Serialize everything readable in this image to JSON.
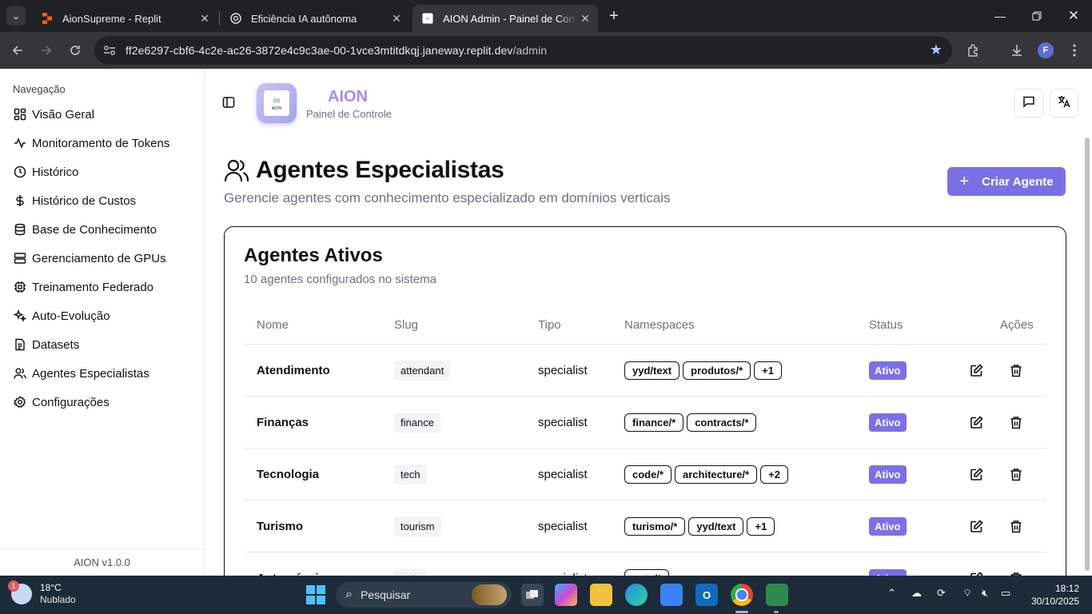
{
  "browser": {
    "tabs": [
      {
        "title": "AionSupreme - Replit",
        "active": false
      },
      {
        "title": "Eficiência IA autônoma",
        "active": false
      },
      {
        "title": "AION Admin - Painel de Controle",
        "active": true
      }
    ],
    "url_host": "ff2e6297-cbf6-4c2e-ac26-3872e4c9c3ae-00-1vce3mtitdkqj.janeway.replit.dev",
    "url_path": "/admin",
    "profile_initial": "F"
  },
  "sidebar": {
    "heading": "Navegação",
    "items": [
      {
        "label": "Visão Geral",
        "icon": "grid-icon"
      },
      {
        "label": "Monitoramento de Tokens",
        "icon": "activity-icon"
      },
      {
        "label": "Histórico",
        "icon": "clock-icon"
      },
      {
        "label": "Histórico de Custos",
        "icon": "dollar-icon"
      },
      {
        "label": "Base de Conhecimento",
        "icon": "database-icon"
      },
      {
        "label": "Gerenciamento de GPUs",
        "icon": "server-icon"
      },
      {
        "label": "Treinamento Federado",
        "icon": "cpu-icon"
      },
      {
        "label": "Auto-Evolução",
        "icon": "sparkles-icon"
      },
      {
        "label": "Datasets",
        "icon": "file-icon"
      },
      {
        "label": "Agentes Especialistas",
        "icon": "users-icon"
      },
      {
        "label": "Configurações",
        "icon": "gear-icon"
      }
    ],
    "footer": "AION v1.0.0"
  },
  "header": {
    "brand_title": "AION",
    "brand_subtitle": "Painel de Controle",
    "logo_text": "AION"
  },
  "page": {
    "title": "Agentes Especialistas",
    "subtitle": "Gerencie agentes com conhecimento especializado em domínios verticais",
    "create_button": "Criar Agente"
  },
  "card": {
    "title": "Agentes Ativos",
    "subtitle": "10 agentes configurados no sistema",
    "columns": [
      "Nome",
      "Slug",
      "Tipo",
      "Namespaces",
      "Status",
      "Ações"
    ],
    "rows": [
      {
        "name": "Atendimento",
        "slug": "attendant",
        "type": "specialist",
        "namespaces": [
          "yyd/text",
          "produtos/*",
          "+1"
        ],
        "status": "Ativo"
      },
      {
        "name": "Finanças",
        "slug": "finance",
        "type": "specialist",
        "namespaces": [
          "finance/*",
          "contracts/*"
        ],
        "status": "Ativo"
      },
      {
        "name": "Tecnologia",
        "slug": "tech",
        "type": "specialist",
        "namespaces": [
          "code/*",
          "architecture/*",
          "+2"
        ],
        "status": "Ativo"
      },
      {
        "name": "Turismo",
        "slug": "tourism",
        "type": "specialist",
        "namespaces": [
          "turismo/*",
          "yyd/text",
          "+1"
        ],
        "status": "Ativo"
      },
      {
        "name": "Automóveis",
        "slug": "auto",
        "type": "specialist",
        "namespaces": [
          "auto/*"
        ],
        "status": "Ativo"
      }
    ]
  },
  "taskbar": {
    "weather_temp": "18°C",
    "weather_desc": "Nublado",
    "weather_badge": "1",
    "search_placeholder": "Pesquisar",
    "time": "18:12",
    "date": "30/10/2025"
  },
  "colors": {
    "accent": "#7c6fe6",
    "brand": "#a78bfa",
    "chrome_dark": "#202124",
    "taskbar": "#1c2a3a"
  }
}
